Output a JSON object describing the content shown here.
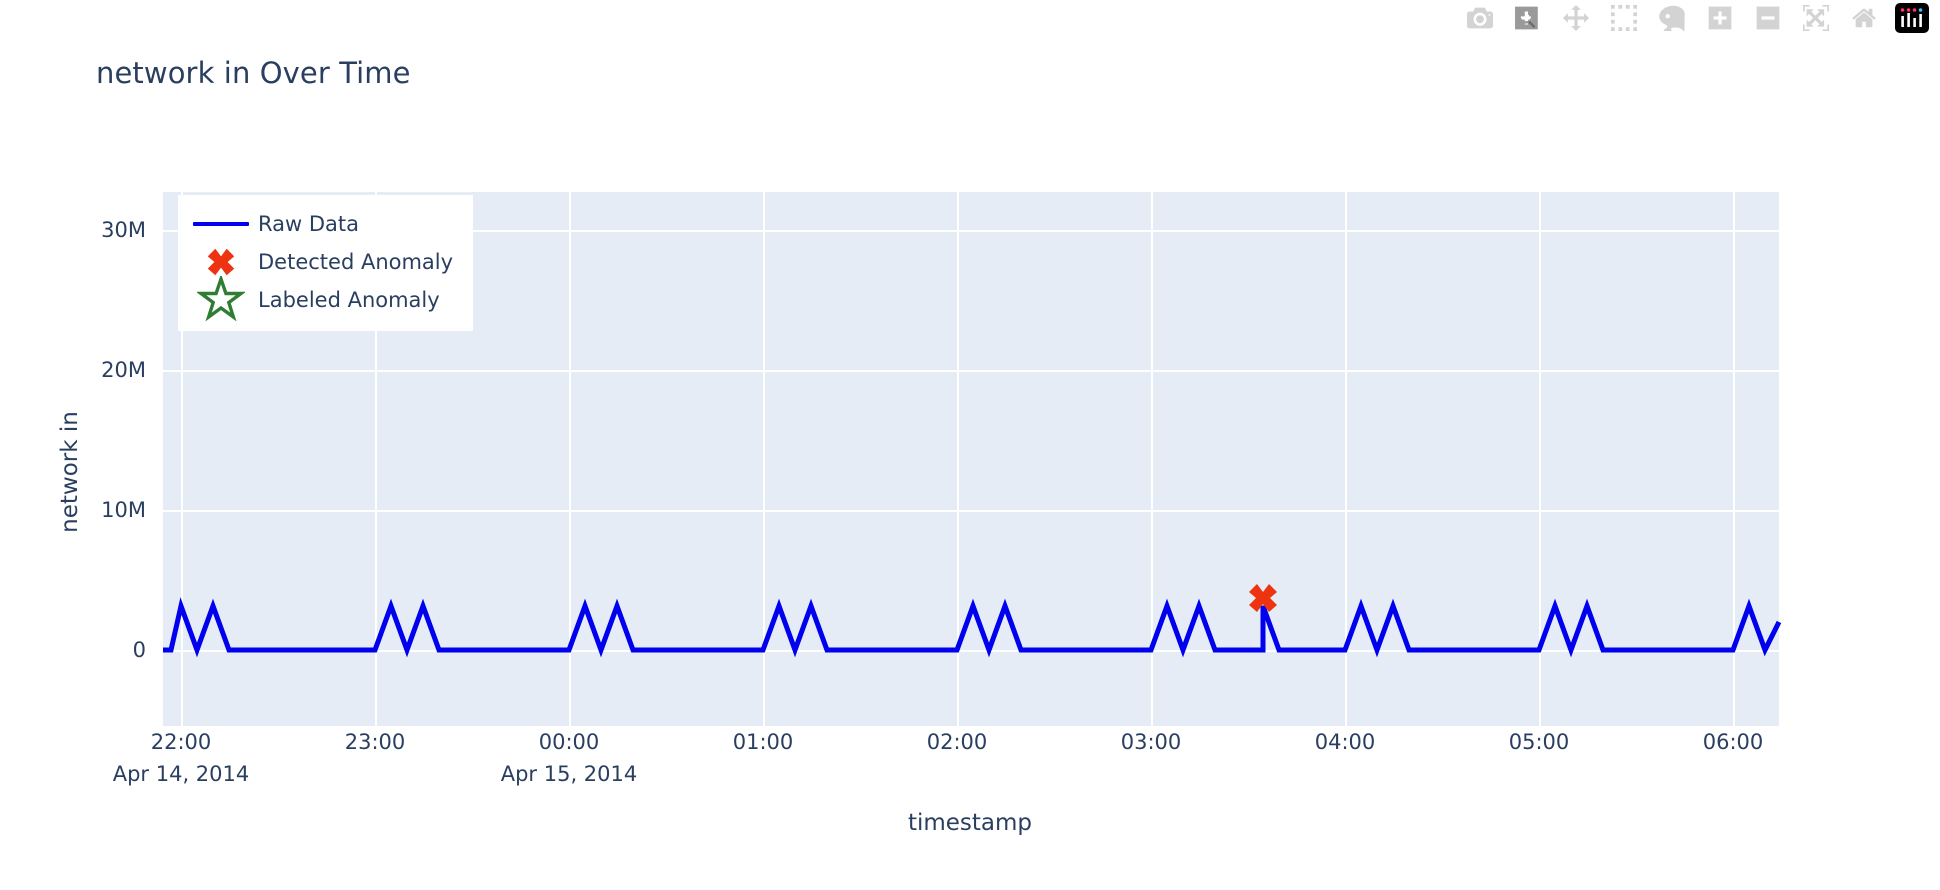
{
  "header": {
    "title": "network in Over Time"
  },
  "modebar": {
    "buttons": [
      {
        "name": "download-plot-as-png-button",
        "icon": "camera-icon",
        "tooltip": "Download plot as a png"
      },
      {
        "name": "zoom-button",
        "icon": "zoom-magnifier-icon",
        "tooltip": "Zoom"
      },
      {
        "name": "pan-button",
        "icon": "pan-arrows-icon",
        "tooltip": "Pan"
      },
      {
        "name": "box-select-button",
        "icon": "box-select-icon",
        "tooltip": "Box Select"
      },
      {
        "name": "lasso-select-button",
        "icon": "lasso-select-icon",
        "tooltip": "Lasso Select"
      },
      {
        "name": "zoom-in-button",
        "icon": "plus-square-icon",
        "tooltip": "Zoom in"
      },
      {
        "name": "zoom-out-button",
        "icon": "minus-square-icon",
        "tooltip": "Zoom out"
      },
      {
        "name": "autoscale-button",
        "icon": "autoscale-icon",
        "tooltip": "Autoscale"
      },
      {
        "name": "reset-axes-button",
        "icon": "home-icon",
        "tooltip": "Reset axes"
      },
      {
        "name": "plotly-logo-button",
        "icon": "plotly-logo-icon",
        "tooltip": "Produced with Plotly"
      }
    ]
  },
  "chart_data": {
    "type": "line",
    "title": "network in Over Time",
    "xlabel": "timestamp",
    "ylabel": "network in",
    "grid": true,
    "legend_position": "top-left-inside",
    "plot_bgcolor": "#E5ECF6",
    "paper_bgcolor": "#FFFFFF",
    "font_color": "#2a3f5f",
    "xlim": [
      "2014-04-14 21:50",
      "2014-04-15 06:10"
    ],
    "ylim": [
      -4000000,
      33000000
    ],
    "ytick_labels": [
      "0",
      "10M",
      "20M",
      "30M"
    ],
    "ytick_values": [
      0,
      10000000,
      20000000,
      30000000
    ],
    "xtick_labels": [
      {
        "time": "22:00",
        "date": "Apr 14, 2014"
      },
      {
        "time": "23:00",
        "date": ""
      },
      {
        "time": "00:00",
        "date": "Apr 15, 2014"
      },
      {
        "time": "01:00",
        "date": ""
      },
      {
        "time": "02:00",
        "date": ""
      },
      {
        "time": "03:00",
        "date": ""
      },
      {
        "time": "04:00",
        "date": ""
      },
      {
        "time": "05:00",
        "date": ""
      },
      {
        "time": "06:00",
        "date": ""
      }
    ],
    "series": [
      {
        "name": "Raw Data",
        "type": "line",
        "color": "#0000EE",
        "width": 5,
        "x": [
          "21:50",
          "21:55",
          "22:00",
          "22:05",
          "22:10",
          "22:15",
          "22:20",
          "22:25",
          "22:30",
          "22:35",
          "22:40",
          "22:45",
          "22:50",
          "22:55",
          "23:00",
          "23:05",
          "23:10",
          "23:15",
          "23:20",
          "23:25",
          "23:30",
          "23:35",
          "23:40",
          "23:45",
          "23:50",
          "23:55",
          "00:00",
          "00:05",
          "00:10",
          "00:15",
          "00:20",
          "00:25",
          "00:30",
          "00:35",
          "00:40",
          "00:45",
          "00:50",
          "00:55",
          "01:00",
          "01:05",
          "01:10",
          "01:15",
          "01:20",
          "01:25",
          "01:30",
          "01:35",
          "01:40",
          "01:45",
          "01:50",
          "01:55",
          "02:00",
          "02:05",
          "02:10",
          "02:15",
          "02:20",
          "02:25",
          "02:30",
          "02:35",
          "02:40",
          "02:45",
          "02:50",
          "02:55",
          "03:00",
          "03:05",
          "03:10",
          "03:15",
          "03:20",
          "03:25",
          "03:30",
          "03:35",
          "03:40",
          "03:45",
          "03:50",
          "03:55",
          "04:00",
          "04:05",
          "04:10",
          "04:15",
          "04:20",
          "04:25",
          "04:30",
          "04:35",
          "04:40",
          "04:45",
          "04:50",
          "04:55",
          "05:00",
          "05:05",
          "05:10",
          "05:15",
          "05:20",
          "05:25",
          "05:30",
          "05:35",
          "05:40",
          "05:45",
          "05:50",
          "05:55",
          "06:00",
          "06:05",
          "06:10"
        ],
        "y": [
          300000,
          400000,
          3000000,
          300000,
          3000000,
          300000,
          300000,
          300000,
          300000,
          300000,
          300000,
          300000,
          300000,
          300000,
          300000,
          3000000,
          300000,
          3000000,
          300000,
          300000,
          300000,
          300000,
          300000,
          300000,
          300000,
          300000,
          300000,
          3000000,
          300000,
          3000000,
          300000,
          300000,
          300000,
          300000,
          300000,
          300000,
          300000,
          300000,
          300000,
          3000000,
          300000,
          3000000,
          300000,
          300000,
          300000,
          300000,
          300000,
          300000,
          300000,
          300000,
          300000,
          3000000,
          300000,
          3000000,
          300000,
          300000,
          300000,
          300000,
          300000,
          300000,
          300000,
          300000,
          300000,
          3000000,
          300000,
          3000000,
          300000,
          300000,
          300000,
          3200000,
          300000,
          300000,
          300000,
          300000,
          300000,
          3000000,
          300000,
          3000000,
          300000,
          300000,
          300000,
          300000,
          300000,
          300000,
          300000,
          300000,
          300000,
          3000000,
          300000,
          3000000,
          300000,
          300000,
          300000,
          300000,
          300000,
          300000,
          300000,
          300000,
          3000000,
          300000,
          3000000
        ]
      },
      {
        "name": "Detected Anomaly",
        "type": "scatter",
        "symbol": "x",
        "color": "#EE3311",
        "points": [
          {
            "x": "03:35",
            "y": 3200000
          }
        ]
      },
      {
        "name": "Labeled Anomaly",
        "type": "scatter",
        "symbol": "star-open",
        "color": "#2E7D32",
        "points": []
      }
    ]
  },
  "legend": {
    "items": [
      {
        "label": "Raw Data",
        "symbol": "line",
        "color": "#0000EE"
      },
      {
        "label": "Detected Anomaly",
        "symbol": "x",
        "color": "#EE3311"
      },
      {
        "label": "Labeled Anomaly",
        "symbol": "star-open",
        "color": "#2E7D32"
      }
    ]
  }
}
